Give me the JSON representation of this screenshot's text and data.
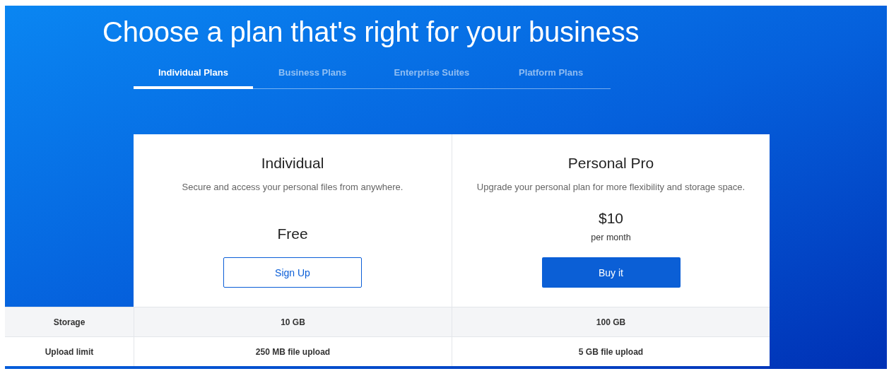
{
  "heading": "Choose a plan that's right for your business",
  "tabs": [
    {
      "label": "Individual Plans",
      "selected": true
    },
    {
      "label": "Business Plans",
      "selected": false
    },
    {
      "label": "Enterprise Suites",
      "selected": false
    },
    {
      "label": "Platform Plans",
      "selected": false
    }
  ],
  "plans": [
    {
      "name": "Individual",
      "description": "Secure and access your personal files from anywhere.",
      "price": "Free",
      "button": {
        "label": "Sign Up",
        "kind": "outline"
      }
    },
    {
      "name": "Personal Pro",
      "description": "Upgrade your personal plan for more flexibility and storage space.",
      "price": "$10",
      "period": "per month",
      "button": {
        "label": "Buy it",
        "kind": "filled"
      }
    }
  ],
  "features": [
    {
      "label": "Storage",
      "values": [
        "10 GB",
        "100 GB"
      ]
    },
    {
      "label": "Upload limit",
      "values": [
        "250 MB file upload",
        "5 GB file upload"
      ]
    }
  ]
}
